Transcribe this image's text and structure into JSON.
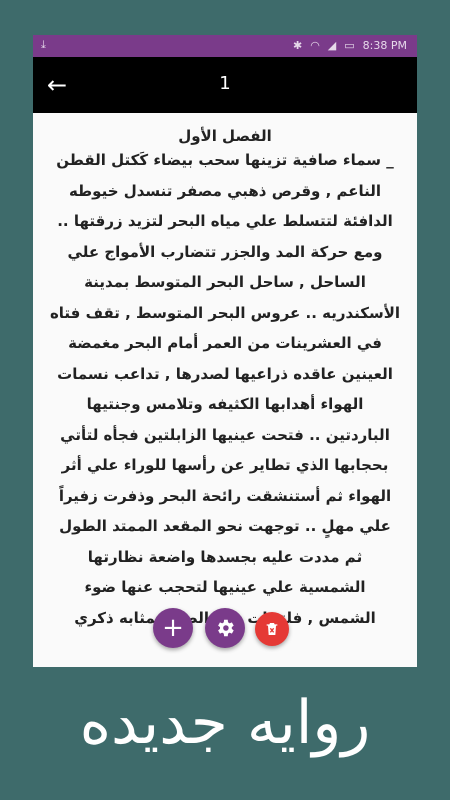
{
  "statusbar": {
    "time": "8:38 PM",
    "download_icon": "download-icon",
    "icons": [
      "bluetooth-icon",
      "wifi-icon",
      "signal-icon",
      "battery-icon"
    ]
  },
  "appbar": {
    "title": "1"
  },
  "content": {
    "chapter_title": "الفصل الأول",
    "lines": [
      "_ سماء صافية تزينها سحب بيضاء كَكتل القطن",
      "الناعم , وقرص ذهبي مصفر تنسدل خيوطه",
      "الدافئة لتتسلط علي مياه البحر لتزيد زرقتها ..",
      "ومع حركة المد والجزر تتضارب الأمواج علي",
      "الساحل , ساحل البحر المتوسط بمدينة",
      "الأسكندريه .. عروس البحر المتوسط , تقف فتاه",
      "في العشرينات من العمر أمام البحر مغمضة",
      "العينين عاقده ذراعيها لصدرها , تداعب نسمات",
      "الهواء أهدابها الكثيفه وتلامس وجنتيها",
      "الباردتين .. فتحت عينيها الزابلتين فجأه لتأتي",
      "بحجابها الذي تطاير عن رأسها للوراء علي أثر",
      "الهواء ثم أستنشقت رائحة البحر وذفرت زفيراً",
      "علي مهلٍ .. توجهت نحو المقعد الممتد الطول",
      "ثم مددت عليه بجسدها واضعة نظارتها",
      "الشمسية علي عينيها لتحجب عنها ضوء",
      "الشمس , فلتتبات ذات الصوء بمثابه ذكري"
    ]
  },
  "fabs": {
    "add_label": "+"
  },
  "banner": {
    "text": "روايه جديده"
  },
  "colors": {
    "background": "#3e6b6b",
    "accent": "#7a3b8a",
    "delete": "#e53935"
  }
}
